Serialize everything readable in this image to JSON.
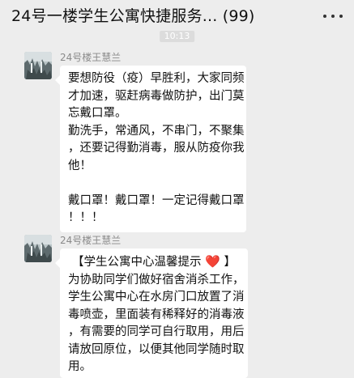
{
  "header": {
    "title": "24号一楼学生公寓快捷服务... (99)",
    "more_icon": "more-dots-icon"
  },
  "timestamp": "10:13",
  "messages": [
    {
      "sender": "24号楼王慧兰",
      "avatar_icon": "avatar-landscape",
      "lines": [
        "要想防役（疫）早胜利，大家同频",
        "才加速，驱赶病毒做防护，出门莫",
        "忘戴口罩。",
        "勤洗手，常通风，不串门，不聚集",
        "，还要记得勤消毒，服从防疫你我",
        "他！",
        "",
        "戴口罩！戴口罩！一定记得戴口罩",
        "！！！"
      ]
    },
    {
      "sender": "24号楼王慧兰",
      "avatar_icon": "avatar-landscape",
      "heading_left": "【学生公寓中心温馨提示",
      "heading_icon": "❤️",
      "heading_right": "】",
      "lines": [
        "为协助同学们做好宿舍消杀工作，",
        "学生公寓中心在水房门口放置了消",
        "毒喷壶，里面装有稀释好的消毒液",
        "，有需要的同学可自行取用，用后",
        "请放回原位，以便其他同学随时取",
        "用。"
      ]
    }
  ],
  "colors": {
    "background": "#ededed",
    "bubble": "#ffffff",
    "sender_text": "#8a8a8a"
  }
}
